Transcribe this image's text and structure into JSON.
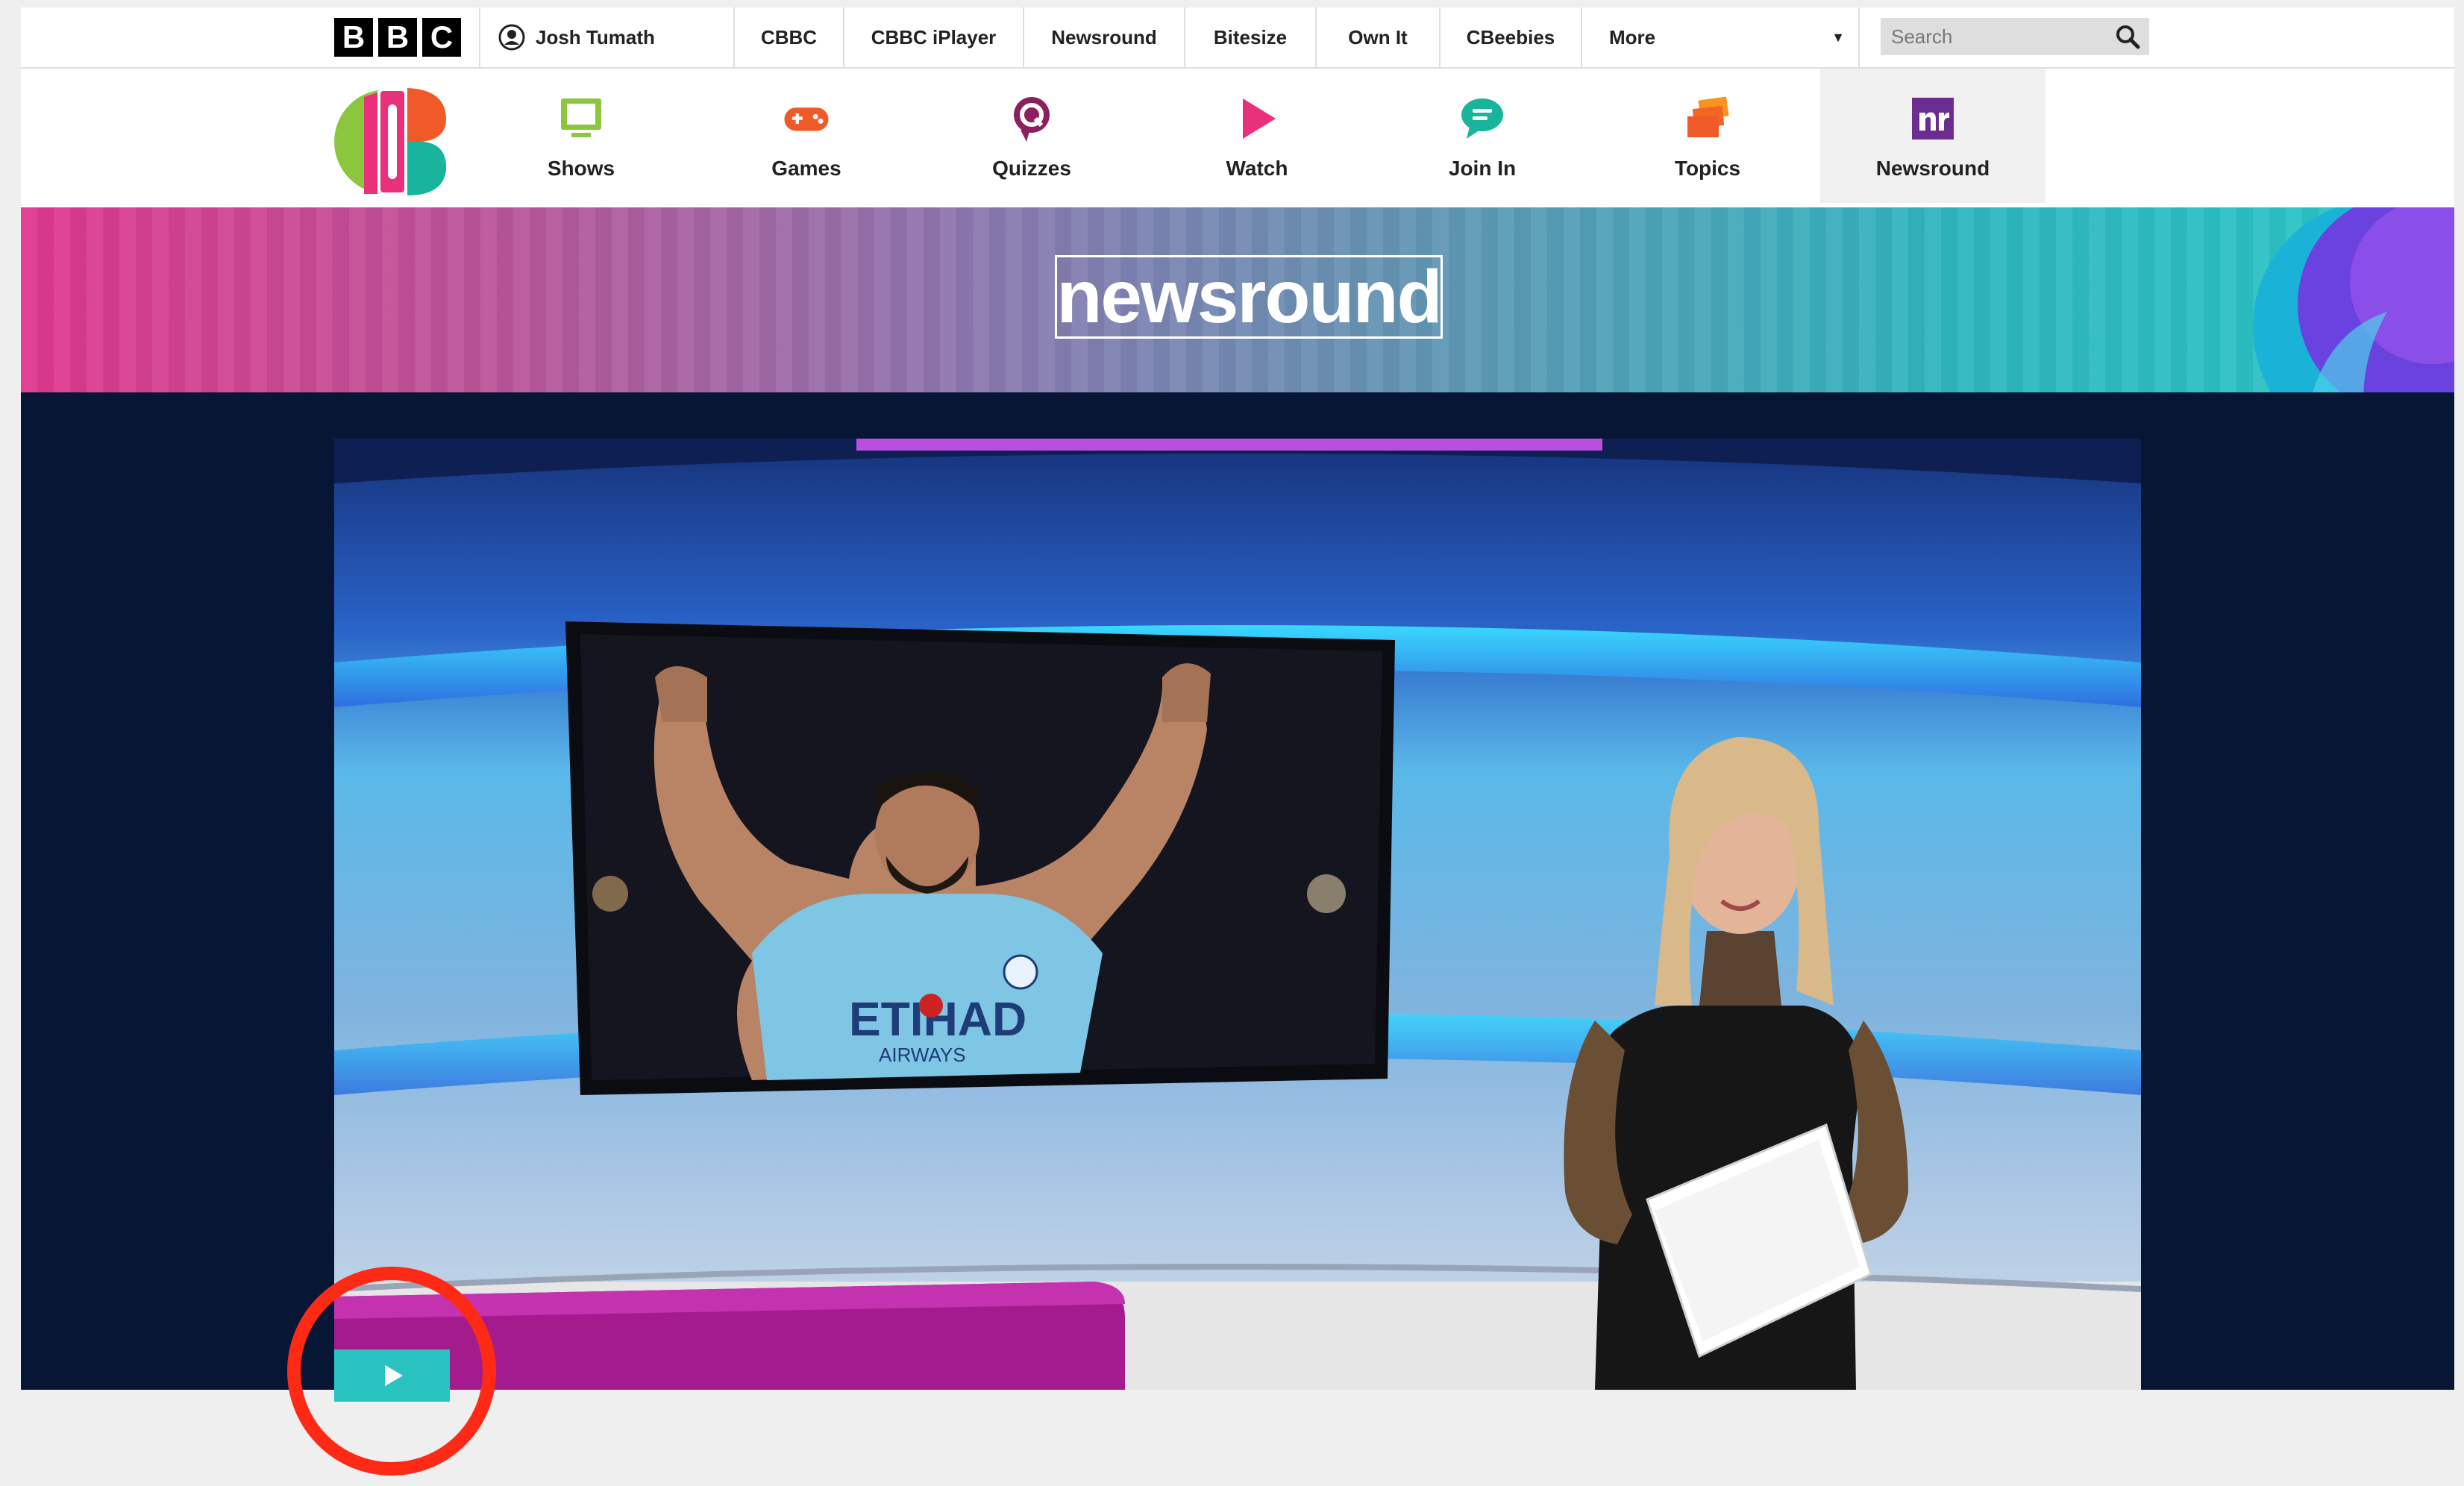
{
  "bbc_bar": {
    "logo_letters": [
      "B",
      "B",
      "C"
    ],
    "account_name": "Josh Tumath",
    "nav": [
      "CBBC",
      "CBBC iPlayer",
      "Newsround",
      "Bitesize",
      "Own It",
      "CBeebies"
    ],
    "more_label": "More",
    "search_placeholder": "Search"
  },
  "cbbc_nav": {
    "items": [
      {
        "label": "Shows",
        "icon": "tv-icon",
        "color": "#8cc63f"
      },
      {
        "label": "Games",
        "icon": "gamepad-icon",
        "color": "#f05a28"
      },
      {
        "label": "Quizzes",
        "icon": "quiz-icon",
        "color": "#8e1f5e"
      },
      {
        "label": "Watch",
        "icon": "play-icon",
        "color": "#e8317a"
      },
      {
        "label": "Join In",
        "icon": "chat-icon",
        "color": "#18b59c"
      },
      {
        "label": "Topics",
        "icon": "stack-icon",
        "color": "#f7941d"
      },
      {
        "label": "Newsround",
        "icon": "nr-icon",
        "color": "#6b2d90",
        "active": true
      }
    ]
  },
  "banner": {
    "logo_text": "newsround"
  },
  "video": {
    "shirt_text": "ETIHAD",
    "shirt_subtext": "AIRWAYS"
  },
  "colors": {
    "accent_teal": "#2ac3c1",
    "highlight_red": "#ff2a16",
    "stage_bg": "#061634"
  }
}
